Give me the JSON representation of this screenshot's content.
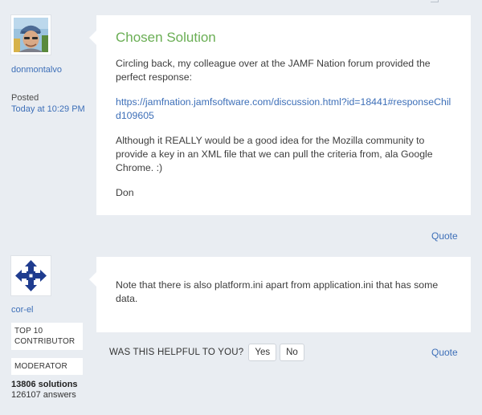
{
  "posts": [
    {
      "author": "donmontalvo",
      "posted_label": "Posted",
      "posted_time": "Today at 10:29 PM",
      "title": "Chosen Solution",
      "paragraphs": [
        "Circling back, my colleague over at the JAMF Nation forum provided the perfect response:",
        "Although it REALLY would be a good idea for the Mozilla community to provide a key in an XML file that we can pull the criteria from, ala Google Chrome. :)",
        "Don"
      ],
      "link_text": "https://jamfnation.jamfsoftware.com/discussion.html?id=18441#responseChild109605",
      "quote_label": "Quote"
    },
    {
      "author": "cor-el",
      "roles": [
        "TOP 10 CONTRIBUTOR",
        "MODERATOR"
      ],
      "solutions": "13806 solutions",
      "answers": "126107 answers",
      "body": "Note that there is also platform.ini apart from application.ini that has some data.",
      "helpful_question": "WAS THIS HELPFUL TO YOU?",
      "yes_label": "Yes",
      "no_label": "No",
      "quote_label": "Quote"
    }
  ],
  "colors": {
    "page_bg": "#e9edf2",
    "card_bg": "#ffffff",
    "link": "#3d6fb8",
    "solution_title": "#6aae54",
    "moderator_avatar": "#1f3c8f"
  }
}
